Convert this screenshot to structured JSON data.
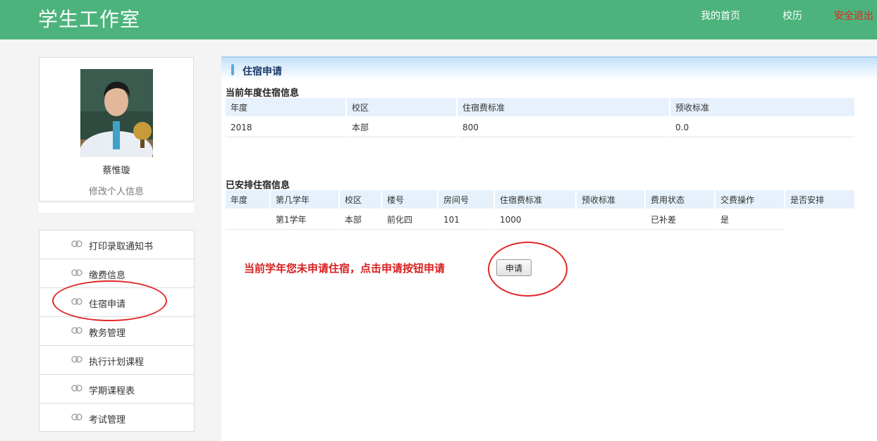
{
  "header": {
    "brand": "学生工作室",
    "nav_home": "我的首页",
    "nav_calendar": "校历",
    "nav_logout": "安全退出"
  },
  "profile": {
    "name": "蔡惟璇",
    "edit_label": "修改个人信息"
  },
  "sidebar": {
    "items": [
      {
        "label": "打印录取通知书"
      },
      {
        "label": "缴费信息"
      },
      {
        "label": "住宿申请"
      },
      {
        "label": "教务管理"
      },
      {
        "label": "执行计划课程"
      },
      {
        "label": "学期课程表"
      },
      {
        "label": "考试管理"
      }
    ]
  },
  "main": {
    "title": "住宿申请",
    "current": {
      "heading": "当前年度住宿信息",
      "headers": [
        "年度",
        "校区",
        "住宿费标准",
        "预收标准"
      ],
      "rows": [
        [
          "2018",
          "本部",
          "800",
          "0.0"
        ]
      ]
    },
    "arranged": {
      "heading": "已安排住宿信息",
      "headers": [
        "年度",
        "第几学年",
        "校区",
        "楼号",
        "房间号",
        "住宿费标准",
        "预收标准",
        "费用状态",
        "交费操作",
        "是否安排"
      ],
      "rows": [
        [
          "",
          "第1学年",
          "本部",
          "前化四",
          "101",
          "1000",
          "",
          "已补差",
          "是"
        ]
      ]
    },
    "notice": "当前学年您未申请住宿，点击申请按钮申请",
    "apply_label": "申请"
  },
  "colors": {
    "header_bg": "#4db37c",
    "logout": "#e0281f",
    "notice": "#d81e1e",
    "annotation": "#e0282a"
  }
}
